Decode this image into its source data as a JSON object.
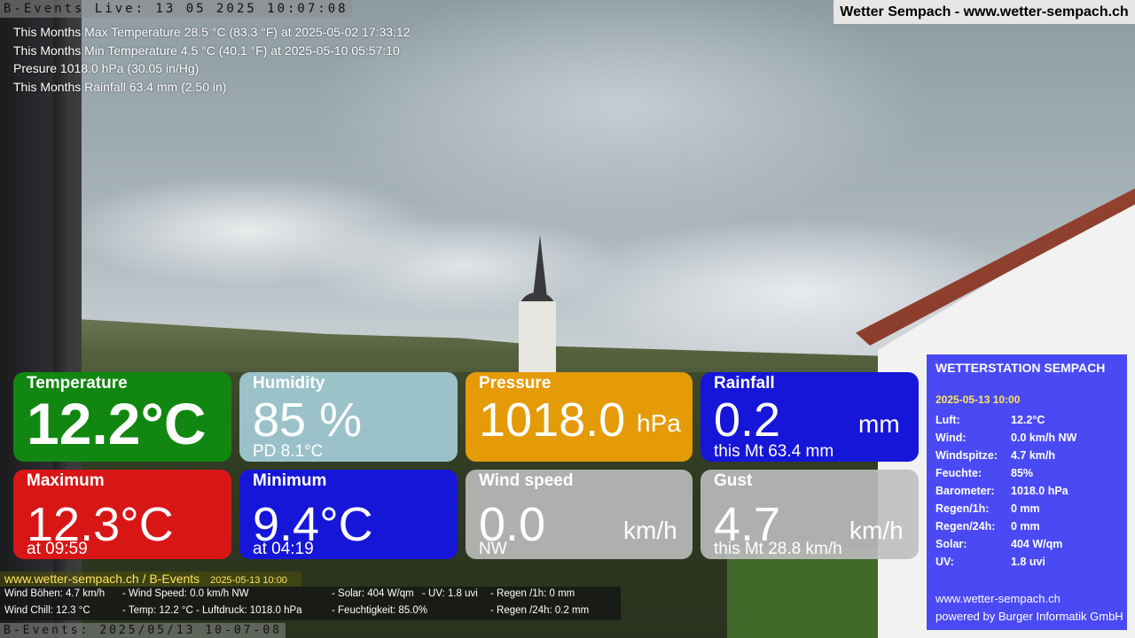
{
  "header": {
    "live_banner": "B-Events Live: 13 05 2025 10:07:08",
    "brand": "Wetter Sempach - www.wetter-sempach.ch"
  },
  "overlay_stats": [
    "This Months Max Temperature 28.5 °C (83.3 °F) at 2025-05-02 17:33:12",
    "This Months Min Temperature 4.5 °C (40.1 °F) at 2025-05-10 05:57:10",
    "Presure 1018.0 hPa (30.05 in/Hg)",
    "This Months Rainfall 63.4 mm (2.50 in)"
  ],
  "tiles": {
    "temperature": {
      "title": "Temperature",
      "value": "12.2°C"
    },
    "humidity": {
      "title": "Humidity",
      "value": "85 %",
      "sub": "PD 8.1°C"
    },
    "pressure": {
      "title": "Pressure",
      "value": "1018.0",
      "unit": "hPa"
    },
    "rainfall": {
      "title": "Rainfall",
      "value": "0.2",
      "unit": "mm",
      "sub": "this Mt 63.4 mm"
    },
    "maximum": {
      "title": "Maximum",
      "value": "12.3°C",
      "sub": "at 09:59"
    },
    "minimum": {
      "title": "Minimum",
      "value": "9.4°C",
      "sub": "at 04:19"
    },
    "wind": {
      "title": "Wind speed",
      "value": "0.0",
      "unit": "km/h",
      "sub": "NW"
    },
    "gust": {
      "title": "Gust",
      "value": "4.7",
      "unit": "km/h",
      "sub": "this Mt 28.8 km/h"
    }
  },
  "station": {
    "title": "WETTERSTATION SEMPACH",
    "date": "2025-05-13 10:00",
    "rows": [
      {
        "key": "Luft:",
        "value": "12.2°C"
      },
      {
        "key": "Wind:",
        "value": "0.0 km/h  NW"
      },
      {
        "key": "Windspitze:",
        "value": "4.7 km/h"
      },
      {
        "key": "Feuchte:",
        "value": "85%"
      },
      {
        "key": "Barometer:",
        "value": "1018.0 hPa"
      },
      {
        "key": "Regen/1h:",
        "value": "0 mm"
      },
      {
        "key": "Regen/24h:",
        "value": "0 mm"
      },
      {
        "key": "Solar:",
        "value": "404 W/qm"
      },
      {
        "key": "UV:",
        "value": "1.8 uvi"
      }
    ],
    "footer_url": "www.wetter-sempach.ch",
    "footer_powered": "powered by Burger Informatik GmbH"
  },
  "ticker": {
    "url": "www.wetter-sempach.ch / B-Events",
    "date": "2025-05-13 10:00",
    "line1": {
      "a": "Wind Böhen: 4.7 km/h",
      "b": "- Wind Speed: 0.0 km/h NW",
      "c": "- Solar: 404 W/qm",
      "d": "- UV: 1.8 uvi",
      "e": "- Regen /1h:   0 mm"
    },
    "line2": {
      "a": "Wind Chill: 12.3 °C",
      "b": "- Temp: 12.2 °C  - Luftdruck: 1018.0 hPa",
      "c": "- Feuchtigkeit: 85.0%",
      "e": "- Regen /24h: 0.2 mm"
    },
    "bottom_banner": "B-Events: 2025/05/13 10-07-08"
  },
  "colors": {
    "temperature": "#118711",
    "humidity": "#a0c8d2",
    "pressure": "#e59a08",
    "rainfall": "#1616d9",
    "maximum": "#d81616",
    "minimum": "#1616d9",
    "wind": "#bebebe",
    "station_panel": "#3c3cf5",
    "highlight": "#ffe45c"
  }
}
